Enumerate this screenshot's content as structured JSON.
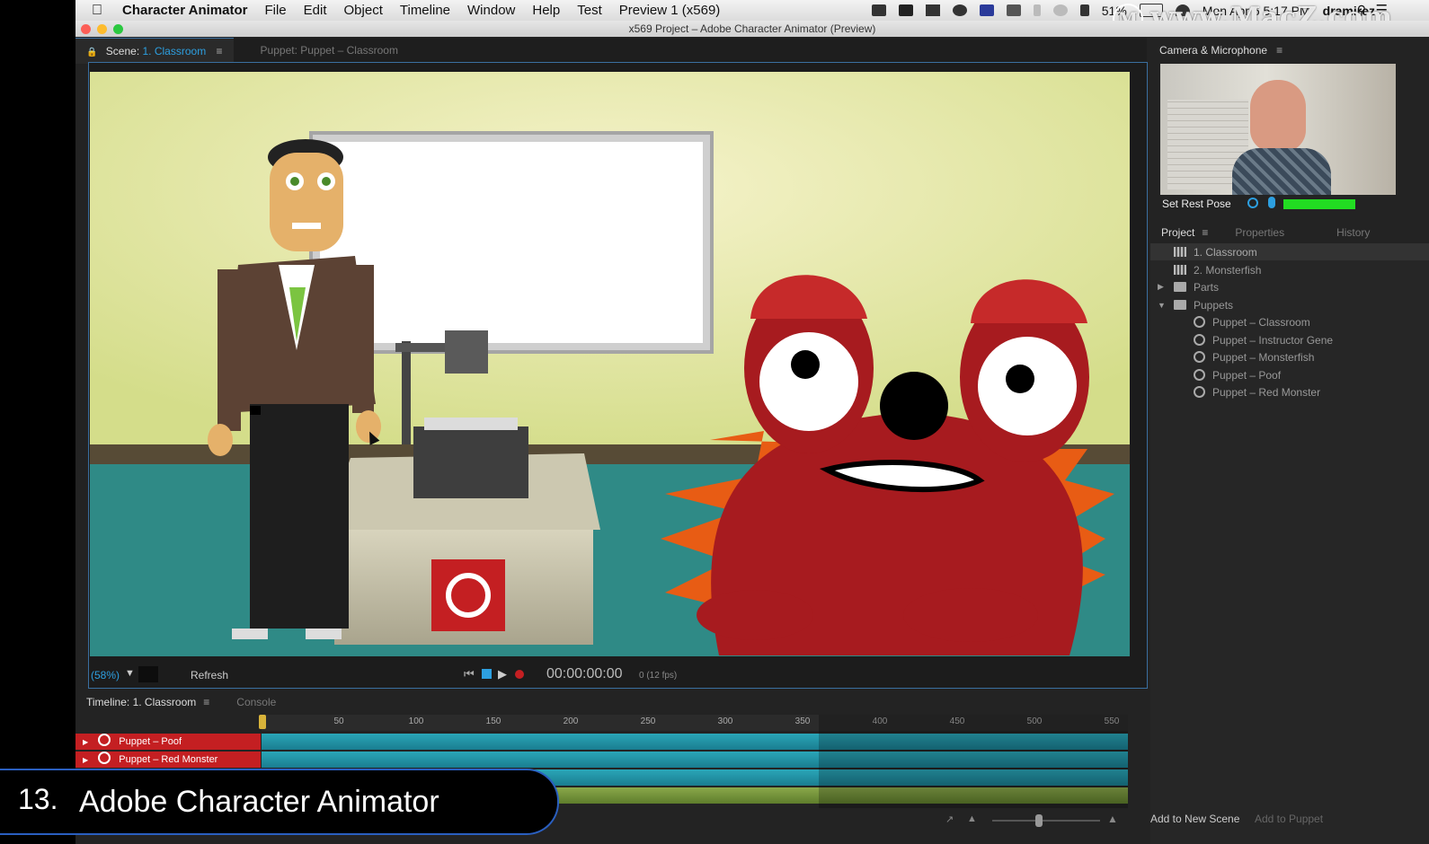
{
  "menubar": {
    "app": "Character Animator",
    "items": [
      "File",
      "Edit",
      "Object",
      "Timeline",
      "Window",
      "Help",
      "Test",
      "Preview 1 (x569)"
    ],
    "battery": "51%",
    "datetime": "Mon Apr 6  5:17 PM",
    "user": "dramirez"
  },
  "watermark": "www.MacZ.com",
  "window_title": "x569 Project – Adobe Character Animator (Preview)",
  "scene_panel": {
    "tab_prefix": "Scene:",
    "tab_scene": "1. Classroom",
    "tab_puppet": "Puppet: Puppet – Classroom",
    "zoom": "(58%)",
    "refresh": "Refresh",
    "timecode": "00:00:00:00",
    "fps": "0 (12 fps)"
  },
  "camera_panel": {
    "title": "Camera & Microphone",
    "set_rest_pose": "Set Rest Pose"
  },
  "project_panel": {
    "tabs": [
      "Project",
      "Properties",
      "History"
    ],
    "items": [
      {
        "label": "1. Classroom",
        "type": "scene",
        "selected": true
      },
      {
        "label": "2. Monsterfish",
        "type": "scene"
      },
      {
        "label": "Parts",
        "type": "folder",
        "collapsed": true
      },
      {
        "label": "Puppets",
        "type": "folder",
        "expanded": true
      },
      {
        "label": "Puppet – Classroom",
        "type": "puppet"
      },
      {
        "label": "Puppet – Instructor Gene",
        "type": "puppet"
      },
      {
        "label": "Puppet – Monsterfish",
        "type": "puppet"
      },
      {
        "label": "Puppet – Poof",
        "type": "puppet"
      },
      {
        "label": "Puppet – Red Monster",
        "type": "puppet"
      }
    ],
    "add_to_new_scene": "Add to New Scene",
    "add_to_puppet": "Add to Puppet"
  },
  "timeline_panel": {
    "tab": "Timeline: 1. Classroom",
    "console": "Console",
    "ticks": [
      "50",
      "100",
      "150",
      "200",
      "250",
      "300",
      "350",
      "400",
      "450",
      "500",
      "550"
    ],
    "tracks": [
      "Puppet – Poof",
      "Puppet – Red Monster"
    ]
  },
  "caption": {
    "number": "13.",
    "text": "Adobe Character Animator"
  },
  "colors": {
    "accent": "#2d9fe0",
    "track_red": "#c41f22",
    "track_teal": "#1f8ea0",
    "level_green": "#22dd22"
  }
}
